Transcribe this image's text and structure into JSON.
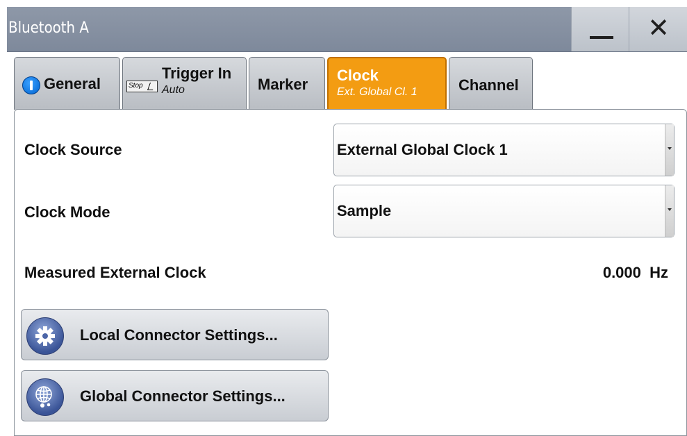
{
  "window": {
    "title": "Bluetooth A"
  },
  "tabs": [
    {
      "label": "General",
      "icon": "info-icon"
    },
    {
      "label": "Trigger In",
      "sub": "Auto",
      "icon_text": "Stop"
    },
    {
      "label": "Marker"
    },
    {
      "label": "Clock",
      "sub": "Ext. Global Cl. 1",
      "active": true
    },
    {
      "label": "Channel"
    }
  ],
  "clock": {
    "source_label": "Clock Source",
    "source_value": "External Global Clock 1",
    "mode_label": "Clock Mode",
    "mode_value": "Sample",
    "measured_label": "Measured External Clock",
    "measured_value": "0.000  Hz",
    "local_button": "Local Connector Settings...",
    "global_button": "Global Connector Settings..."
  },
  "colors": {
    "active_tab": "#f39c12",
    "titlebar": "#8792a3"
  }
}
